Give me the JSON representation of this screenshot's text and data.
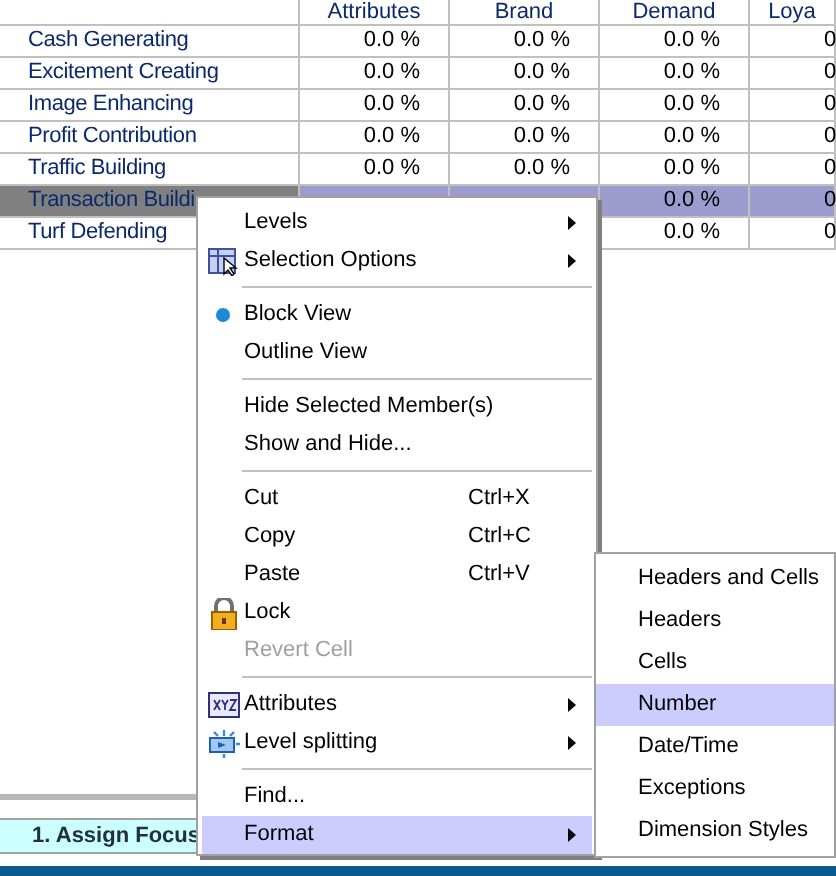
{
  "grid": {
    "columns": [
      "Attributes",
      "Brand",
      "Demand",
      "Loya"
    ],
    "rows": [
      {
        "label": "Cash Generating",
        "selected": false,
        "cells": [
          "0.0 %",
          "0.0 %",
          "0.0 %",
          "0"
        ]
      },
      {
        "label": "Excitement Creating",
        "selected": false,
        "cells": [
          "0.0 %",
          "0.0 %",
          "0.0 %",
          "0"
        ]
      },
      {
        "label": "Image Enhancing",
        "selected": false,
        "cells": [
          "0.0 %",
          "0.0 %",
          "0.0 %",
          "0"
        ]
      },
      {
        "label": "Profit Contribution",
        "selected": false,
        "cells": [
          "0.0 %",
          "0.0 %",
          "0.0 %",
          "0"
        ]
      },
      {
        "label": "Traffic Building",
        "selected": false,
        "cells": [
          "0.0 %",
          "0.0 %",
          "0.0 %",
          "0"
        ]
      },
      {
        "label": "Transaction Buildi",
        "selected": true,
        "cells": [
          null,
          null,
          "0.0 %",
          "0"
        ]
      },
      {
        "label": "Turf Defending",
        "selected": false,
        "cells": [
          null,
          null,
          "0.0 %",
          "0"
        ]
      }
    ]
  },
  "context_menu": [
    {
      "kind": "item",
      "label": "Levels",
      "submenu": true,
      "selected": false,
      "disabled": false
    },
    {
      "kind": "item",
      "label": "Selection Options",
      "submenu": true,
      "selected": false,
      "disabled": false
    },
    {
      "kind": "separator"
    },
    {
      "kind": "radio",
      "label": "Block View",
      "checked": true,
      "selected": false,
      "disabled": false
    },
    {
      "kind": "radio",
      "label": "Outline View",
      "checked": false,
      "selected": false,
      "disabled": false
    },
    {
      "kind": "separator"
    },
    {
      "kind": "item",
      "label": "Hide Selected Member(s)",
      "submenu": false,
      "selected": false,
      "disabled": false
    },
    {
      "kind": "item",
      "label": "Show and Hide...",
      "submenu": false,
      "selected": false,
      "disabled": false
    },
    {
      "kind": "separator"
    },
    {
      "kind": "item",
      "label": "Cut",
      "shortcut": "Ctrl+X",
      "submenu": false,
      "selected": false,
      "disabled": false
    },
    {
      "kind": "item",
      "label": "Copy",
      "shortcut": "Ctrl+C",
      "submenu": false,
      "selected": false,
      "disabled": false
    },
    {
      "kind": "item",
      "label": "Paste",
      "shortcut": "Ctrl+V",
      "submenu": false,
      "selected": false,
      "disabled": false
    },
    {
      "kind": "item",
      "label": "Lock",
      "submenu": false,
      "selected": false,
      "disabled": false
    },
    {
      "kind": "item",
      "label": "Revert Cell",
      "submenu": false,
      "selected": false,
      "disabled": true
    },
    {
      "kind": "separator"
    },
    {
      "kind": "item",
      "label": "Attributes",
      "submenu": true,
      "selected": false,
      "disabled": false
    },
    {
      "kind": "item",
      "label": "Level splitting",
      "submenu": true,
      "selected": false,
      "disabled": false
    },
    {
      "kind": "separator"
    },
    {
      "kind": "item",
      "label": "Find...",
      "submenu": false,
      "selected": false,
      "disabled": false
    },
    {
      "kind": "item",
      "label": "Format",
      "submenu": true,
      "selected": true,
      "disabled": false
    }
  ],
  "format_submenu": [
    {
      "label": "Headers and Cells",
      "selected": false
    },
    {
      "label": "Headers",
      "selected": false
    },
    {
      "label": "Cells",
      "selected": false
    },
    {
      "label": "Number",
      "selected": true
    },
    {
      "label": "Date/Time",
      "selected": false
    },
    {
      "label": "Exceptions",
      "selected": false
    },
    {
      "label": "Dimension Styles",
      "selected": false
    }
  ],
  "bottom_tab": {
    "label": "1. Assign Focus"
  }
}
